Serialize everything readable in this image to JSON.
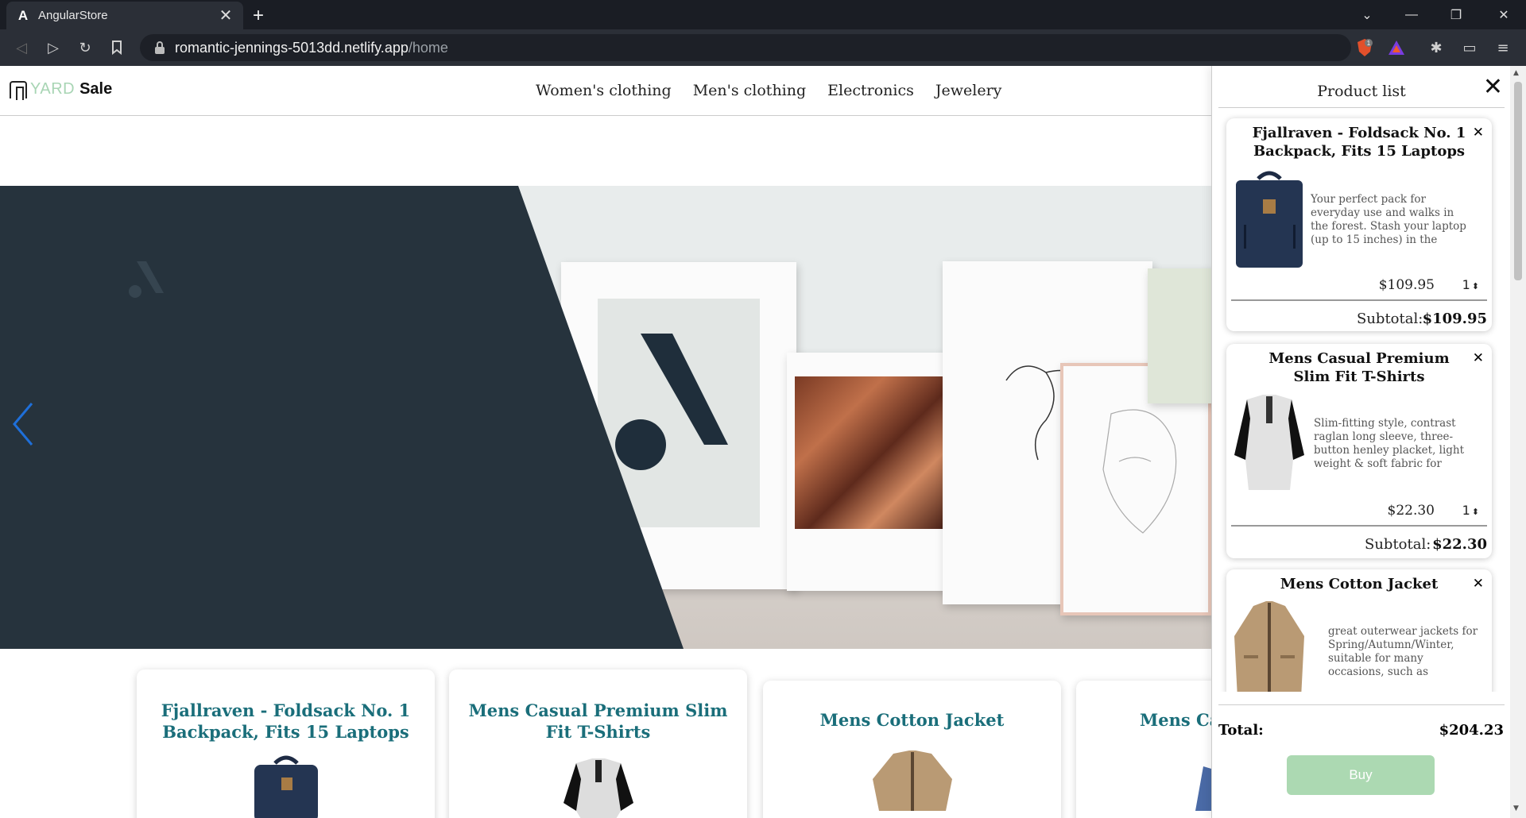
{
  "browser": {
    "tab_title": "AngularStore",
    "tab_favicon": "A",
    "url_host": "romantic-jennings-5013dd.netlify.app",
    "url_path": "/home",
    "brave_badge": "1"
  },
  "site": {
    "logo_yard": "YARD",
    "logo_sale": "Sale",
    "nav": [
      "Women's clothing",
      "Men's clothing",
      "Electronics",
      "Jewelery"
    ]
  },
  "products": [
    {
      "title": "Fjallraven - Foldsack No. 1 Backpack, Fits 15 Laptops"
    },
    {
      "title": "Mens Casual Premium Slim Fit T-Shirts"
    },
    {
      "title": "Mens Cotton Jacket"
    },
    {
      "title": "Mens Ca"
    }
  ],
  "cart": {
    "title": "Product list",
    "items": [
      {
        "title": "Fjallraven - Foldsack No. 1 Backpack, Fits 15 Laptops",
        "description": "Your perfect pack for everyday use and walks in the forest. Stash your laptop (up to 15 inches) in the padded sleeve, your everyday",
        "price": "$109.95",
        "qty": "1",
        "subtotal_label": "Subtotal:",
        "subtotal": "$109.95"
      },
      {
        "title": "Mens Casual Premium Slim Fit T-Shirts",
        "description": "Slim-fitting style, contrast raglan long sleeve, three-button henley placket, light weight & soft fabric for breathable and comfortable…",
        "price": "$22.30",
        "qty": "1",
        "subtotal_label": "Subtotal:",
        "subtotal": "$22.30"
      },
      {
        "title": "Mens Cotton Jacket",
        "description": "great outerwear jackets for Spring/Autumn/Winter, suitable for many occasions, such as working, hiking,…"
      }
    ],
    "total_label": "Total:",
    "total_value": "$204.23",
    "buy_label": "Buy"
  }
}
